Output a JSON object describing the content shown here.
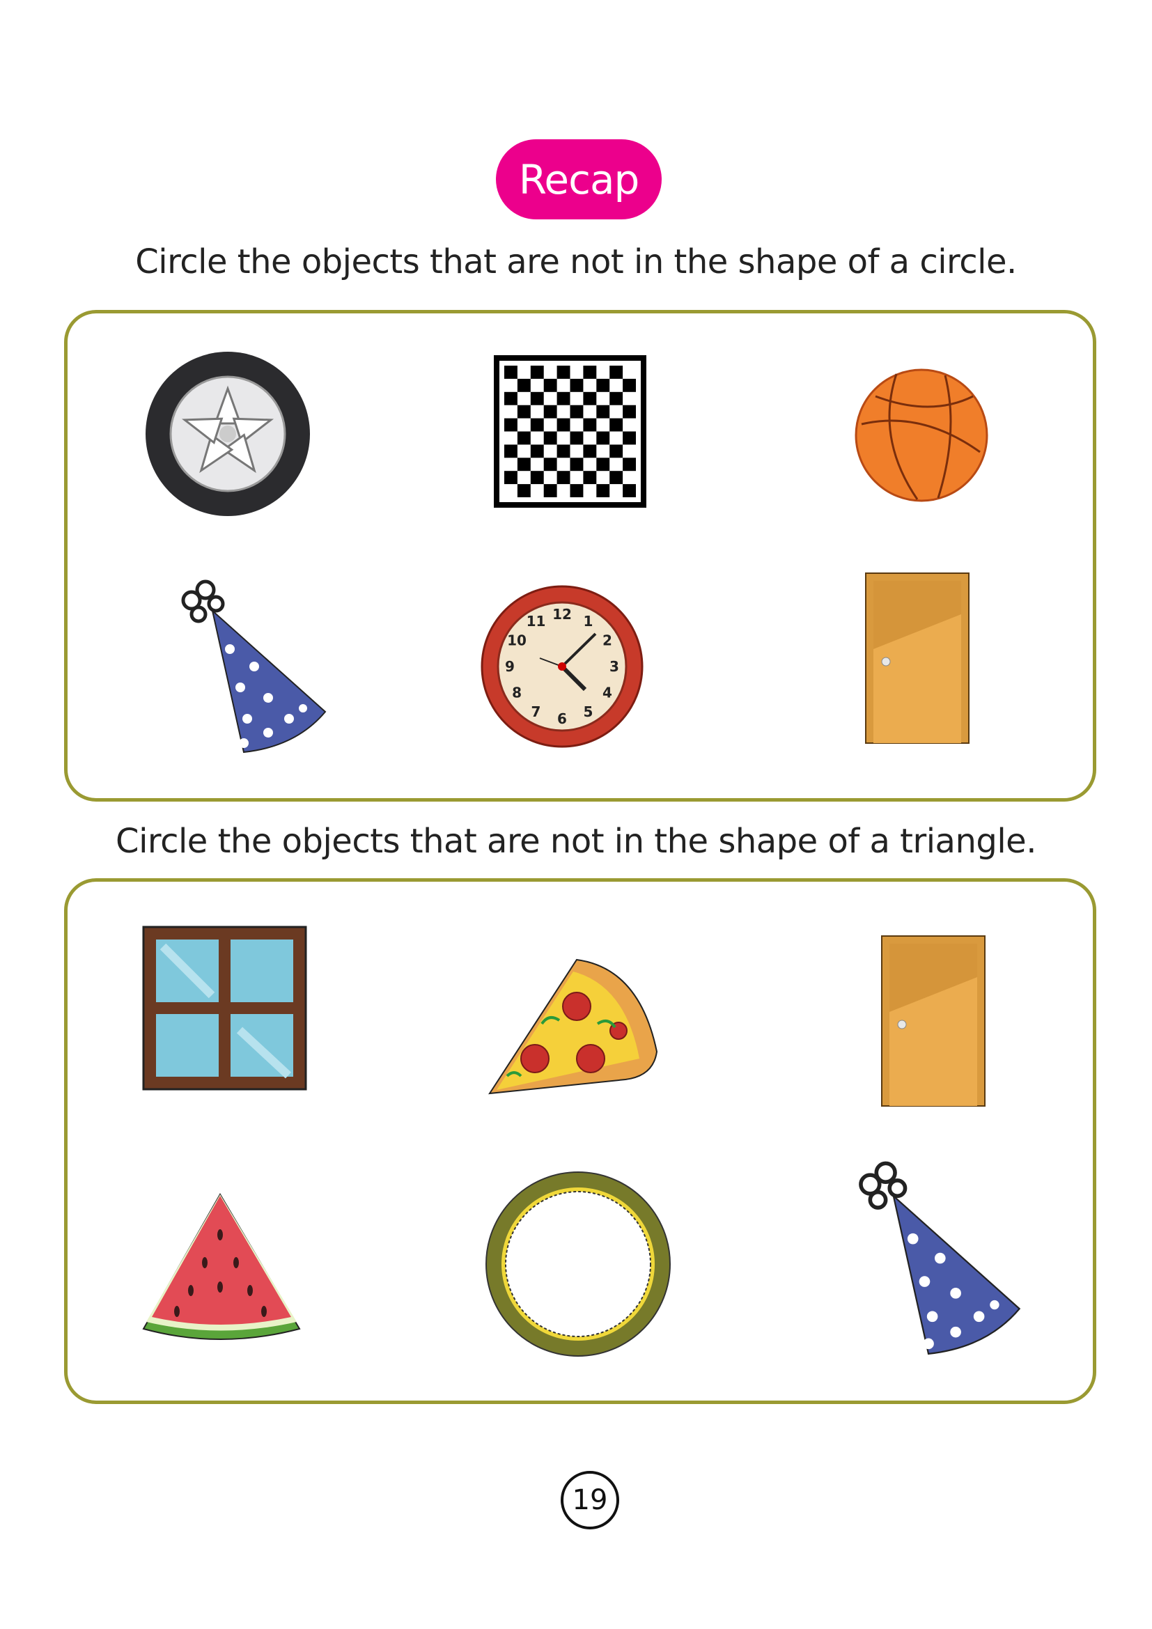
{
  "header": {
    "badge": "Recap",
    "badge_color": "#ec008c"
  },
  "sections": [
    {
      "instruction": "Circle the objects that are not in the shape of a circle.",
      "objects": [
        "tire",
        "chessboard",
        "basketball",
        "party-hat",
        "clock",
        "door"
      ]
    },
    {
      "instruction": "Circle the objects that are not in the shape of a triangle.",
      "objects": [
        "window",
        "pizza-slice",
        "door",
        "watermelon-slice",
        "ring",
        "party-hat"
      ]
    }
  ],
  "clock_numerals": [
    "12",
    "1",
    "2",
    "3",
    "4",
    "5",
    "6",
    "7",
    "8",
    "9",
    "10",
    "11"
  ],
  "footer": {
    "page_number": "19"
  },
  "colors": {
    "box_border": "#9a9a32"
  }
}
